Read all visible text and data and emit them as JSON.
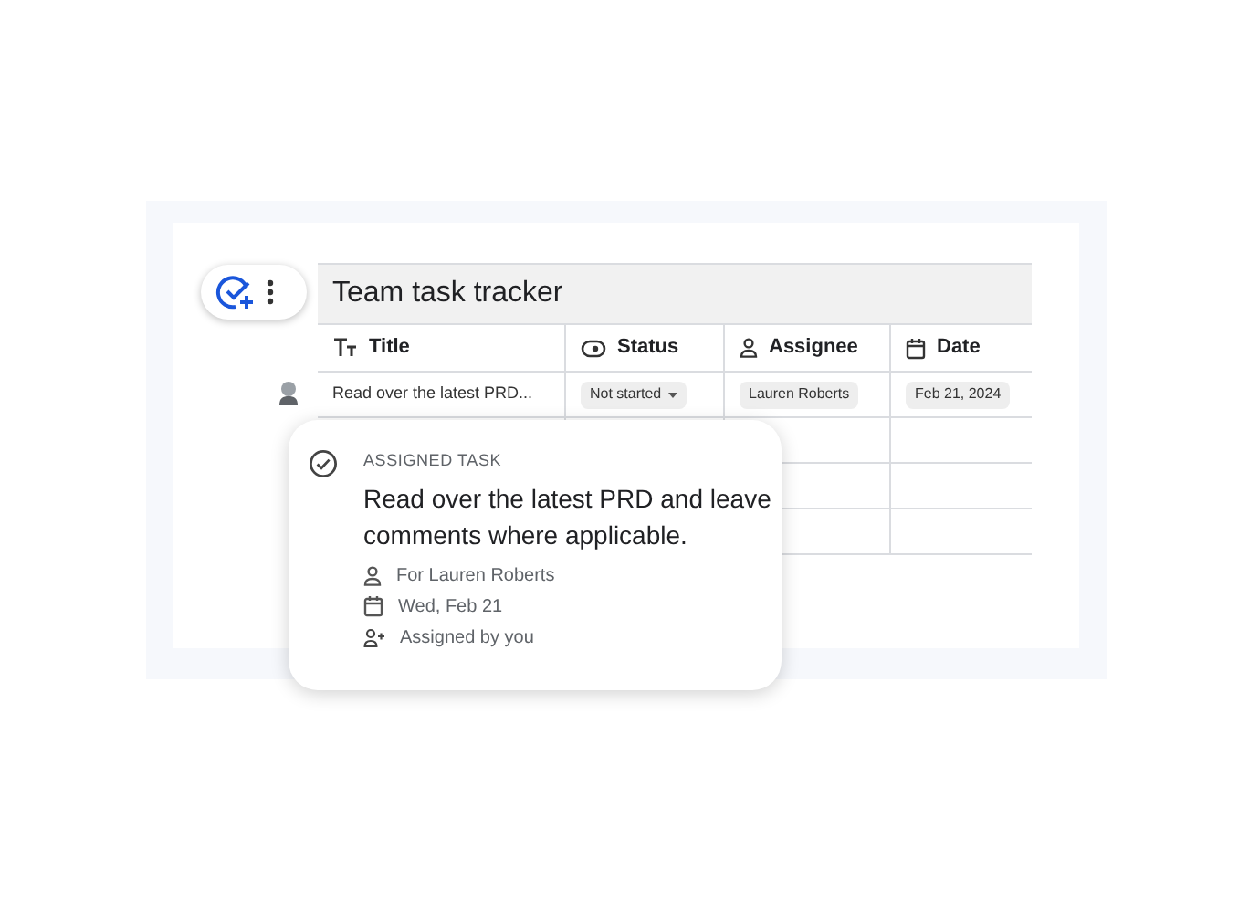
{
  "sheet": {
    "title": "Team task tracker",
    "columns": [
      {
        "label": "Title",
        "kind": "text"
      },
      {
        "label": "Status",
        "kind": "status"
      },
      {
        "label": "Assignee",
        "kind": "person"
      },
      {
        "label": "Date",
        "kind": "date"
      }
    ],
    "rows": [
      {
        "cells": [
          "Read over the latest PRD...",
          "Not started",
          "Lauren Roberts",
          "Feb 21, 2024"
        ]
      }
    ]
  },
  "task_card": {
    "label": "ASSIGNED TASK",
    "title": "Read over the latest PRD and leave comments where applicable.",
    "details": [
      {
        "kind": "person",
        "text": "For Lauren Roberts"
      },
      {
        "kind": "date",
        "text": "Wed, Feb 21"
      },
      {
        "kind": "assigner",
        "text": "Assigned by you"
      }
    ]
  }
}
